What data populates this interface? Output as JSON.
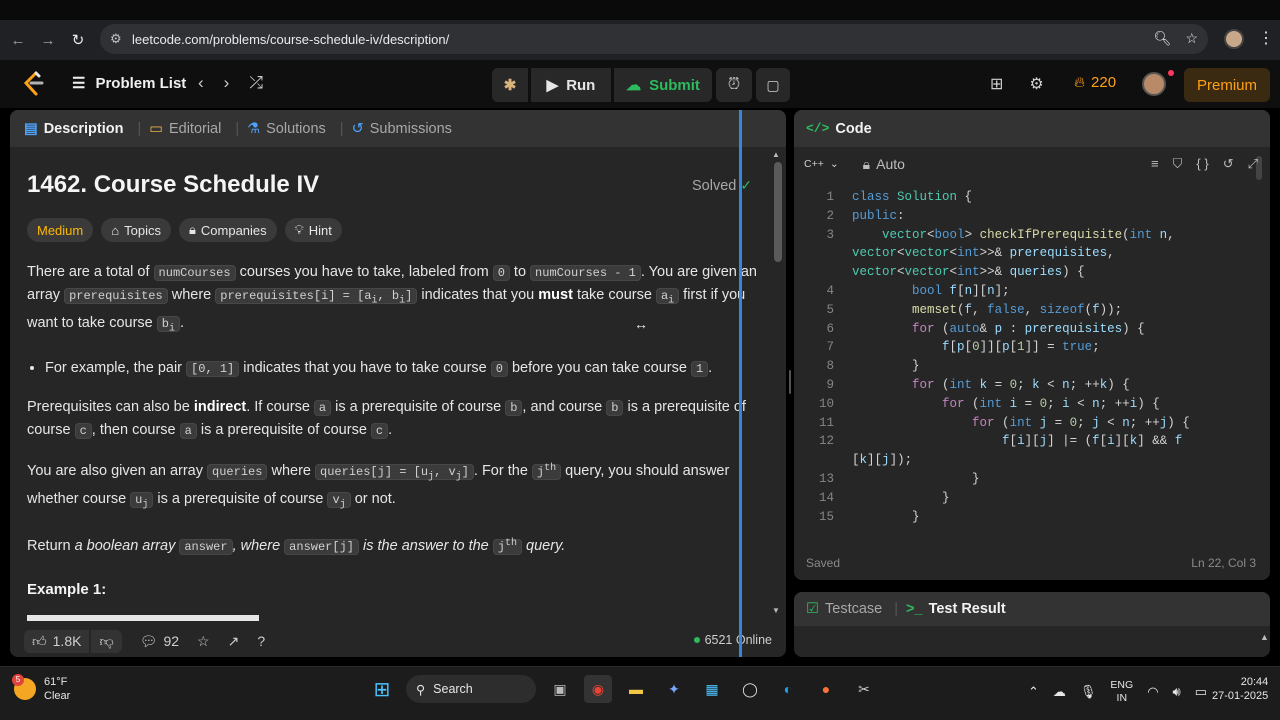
{
  "browser": {
    "url": "leetcode.com/problems/course-schedule-iv/description/"
  },
  "topbar": {
    "problem_list": "Problem List",
    "run": "Run",
    "submit": "Submit",
    "streak": "220",
    "premium": "Premium"
  },
  "left": {
    "tabs": [
      "Description",
      "Editorial",
      "Solutions",
      "Submissions"
    ],
    "title": "1462. Course Schedule IV",
    "solved": "Solved",
    "chips": [
      "Medium",
      "Topics",
      "Companies",
      "Hint"
    ],
    "example_heading": "Example 1:",
    "likes": "1.8K",
    "comments": "92",
    "online": "6521 Online"
  },
  "code": {
    "title": "Code",
    "language": "C++",
    "mode": "Auto",
    "saved": "Saved",
    "position": "Ln 22, Col 3",
    "line_numbers": [
      "1",
      "2",
      "3",
      "",
      "",
      "4",
      "5",
      "6",
      "7",
      "8",
      "9",
      "10",
      "11",
      "12",
      "",
      "13",
      "14",
      "15"
    ]
  },
  "test": {
    "tabs": [
      "Testcase",
      "Test Result"
    ]
  },
  "taskbar": {
    "weather_temp": "61°F",
    "weather_desc": "Clear",
    "weather_badge": "5",
    "search": "Search",
    "lang_top": "ENG",
    "lang_bottom": "IN",
    "time": "20:44",
    "date": "27-01-2025"
  }
}
